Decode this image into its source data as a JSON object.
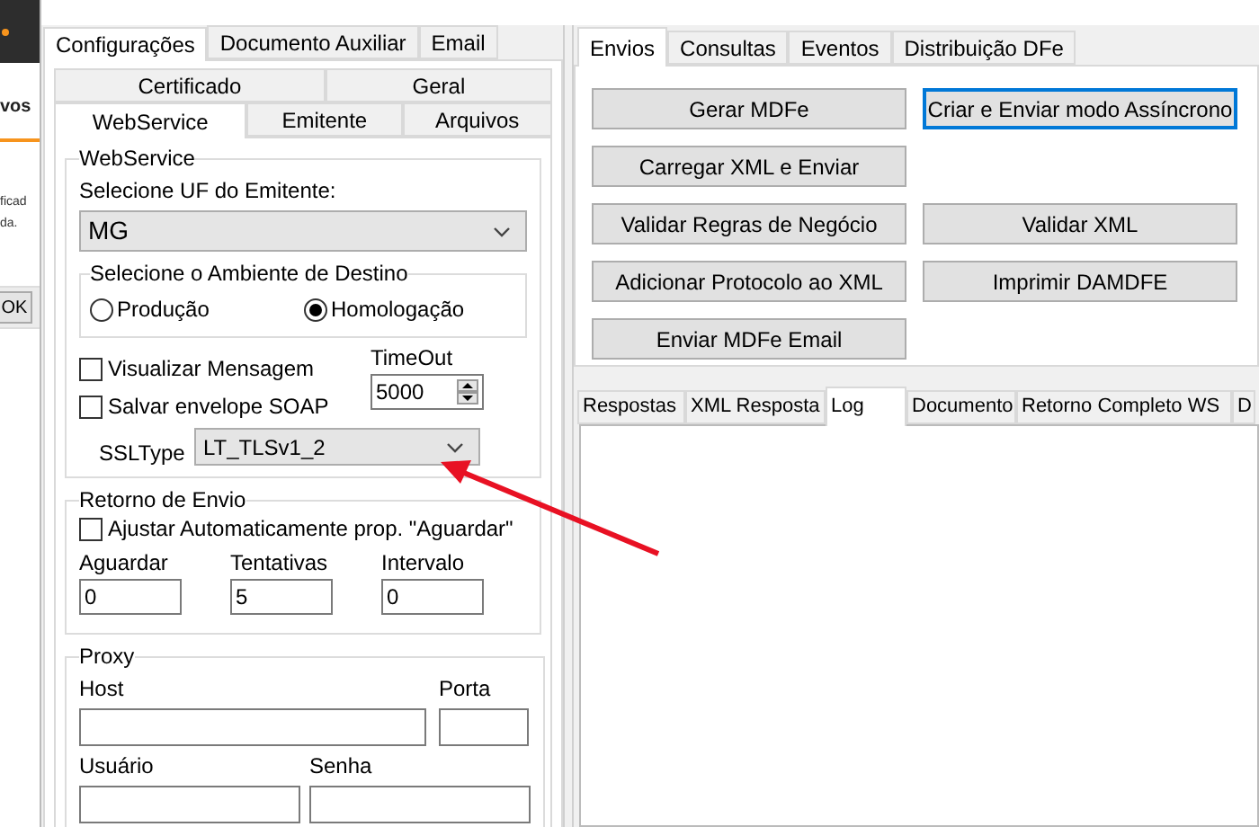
{
  "background_window": {
    "texts": [
      "vos",
      "ficad",
      "da."
    ],
    "button": "OK"
  },
  "main_tabs": [
    {
      "label": "Configurações",
      "selected": true
    },
    {
      "label": "Documento Auxiliar",
      "selected": false
    },
    {
      "label": "Email",
      "selected": false
    }
  ],
  "config_tabs_row_1": [
    {
      "label": "Certificado",
      "selected": false
    },
    {
      "label": "Geral",
      "selected": false
    }
  ],
  "config_tabs_row_2": [
    {
      "label": "WebService",
      "selected": true
    },
    {
      "label": "Emitente",
      "selected": false
    },
    {
      "label": "Arquivos",
      "selected": false
    }
  ],
  "webservice": {
    "title": "WebService",
    "uf_label": "Selecione UF do Emitente:",
    "uf": "MG",
    "ambiente": {
      "title": "Selecione o Ambiente de Destino",
      "options": [
        {
          "label": "Produção",
          "selected": false
        },
        {
          "label": "Homologação",
          "selected": true
        }
      ]
    },
    "checkboxes": [
      {
        "label": "Visualizar Mensagem",
        "checked": false
      },
      {
        "label": "Salvar envelope SOAP",
        "checked": false
      }
    ],
    "timeout_label": "TimeOut",
    "timeout": "5000",
    "ssl_label": "SSLType",
    "ssl": "LT_TLSv1_2"
  },
  "retorno": {
    "title": "Retorno de Envio",
    "checkbox": {
      "label": "Ajustar Automaticamente prop. \"Aguardar\"",
      "checked": false
    },
    "fields": [
      {
        "label": "Aguardar",
        "value": "0"
      },
      {
        "label": "Tentativas",
        "value": "5"
      },
      {
        "label": "Intervalo",
        "value": "0"
      }
    ]
  },
  "proxy": {
    "title": "Proxy",
    "fields": [
      {
        "label": "Host"
      },
      {
        "label": "Porta"
      },
      {
        "label": "Usuário"
      },
      {
        "label": "Senha"
      }
    ]
  },
  "right_tabs": [
    {
      "label": "Envios",
      "selected": true
    },
    {
      "label": "Consultas",
      "selected": false
    },
    {
      "label": "Eventos",
      "selected": false
    },
    {
      "label": "Distribuição DFe",
      "selected": false
    }
  ],
  "button_rows": [
    [
      {
        "label": "Gerar MDFe",
        "focused": false
      },
      {
        "label": "Criar e Enviar modo Assíncrono",
        "focused": true
      }
    ],
    [
      {
        "label": "Carregar XML e Enviar",
        "focused": false
      }
    ],
    [
      {
        "label": "Validar Regras de Negócio",
        "focused": false
      },
      {
        "label": "Validar XML",
        "focused": false
      }
    ],
    [
      {
        "label": "Adicionar Protocolo ao XML",
        "focused": false
      },
      {
        "label": "Imprimir DAMDFE",
        "focused": false
      }
    ],
    [
      {
        "label": "Enviar MDFe Email",
        "focused": false
      }
    ]
  ],
  "result_tabs": [
    {
      "label": "Respostas",
      "selected": false
    },
    {
      "label": "XML Resposta",
      "selected": false
    },
    {
      "label": "Log",
      "selected": true
    },
    {
      "label": "Documento",
      "selected": false
    },
    {
      "label": "Retorno Completo WS",
      "selected": false
    },
    {
      "label": "D",
      "selected": false
    }
  ]
}
